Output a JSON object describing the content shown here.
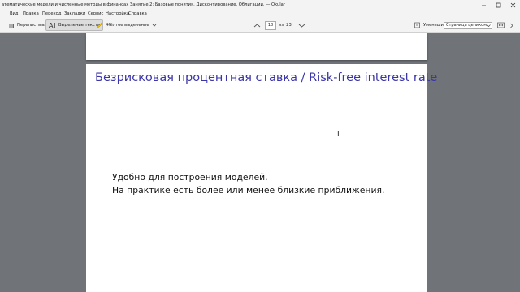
{
  "window": {
    "title": "атематические модели и численные методы в финансах Занятие 2: Базовые понятия. Дисконтирование. Облигации. — Okular"
  },
  "menu": {
    "items": [
      "Вид",
      "Правка",
      "Переход",
      "Закладки",
      "Сервис",
      "Настройка",
      "Справка"
    ]
  },
  "toolbar": {
    "browse_label": "Перелистывание",
    "select_text_label": "Выделение текста",
    "highlight_label": "Жёлтое выделение",
    "page_current": "18",
    "page_of": "из",
    "page_total": "23",
    "zoom_out_label": "Уменьшить",
    "zoom_mode": "Страница целиком"
  },
  "slide": {
    "title": "Безрисковая процентная ставка / Risk-free interest rate",
    "lines": [
      "Удобно для построения моделей.",
      "На практике есть более или менее близкие приближения."
    ]
  },
  "colors": {
    "slide_title": "#3a35a8",
    "background": "#707478"
  }
}
